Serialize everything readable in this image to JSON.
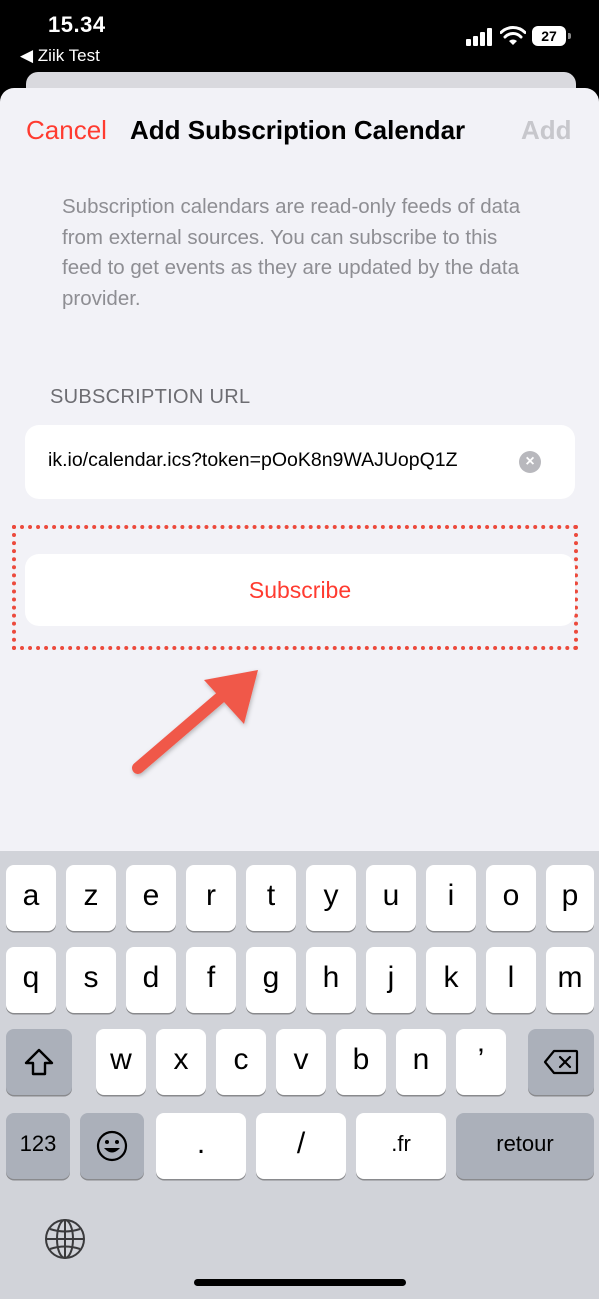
{
  "status_bar": {
    "time": "15.34",
    "back_app": "◀ Ziik Test",
    "battery": "27"
  },
  "nav": {
    "cancel": "Cancel",
    "title": "Add Subscription Calendar",
    "add": "Add"
  },
  "info_text": "Subscription calendars are read-only feeds of data from external sources. You can subscribe to this feed to get events as they are updated by the data provider.",
  "url_section": {
    "label": "SUBSCRIPTION URL",
    "value": "ik.io/calendar.ics?token=pOoK8n9WAJUopQ1Z"
  },
  "subscribe_label": "Subscribe",
  "colors": {
    "accent": "#ff3b30",
    "annotation": "#ec4a3c",
    "arrow": "#f0584a"
  },
  "keyboard": {
    "row1": [
      "a",
      "z",
      "e",
      "r",
      "t",
      "y",
      "u",
      "i",
      "o",
      "p"
    ],
    "row2": [
      "q",
      "s",
      "d",
      "f",
      "g",
      "h",
      "j",
      "k",
      "l",
      "m"
    ],
    "row3": [
      "w",
      "x",
      "c",
      "v",
      "b",
      "n",
      "’"
    ],
    "numbers": "123",
    "period": ".",
    "slash": "/",
    "domain": ".fr",
    "return": "retour"
  }
}
